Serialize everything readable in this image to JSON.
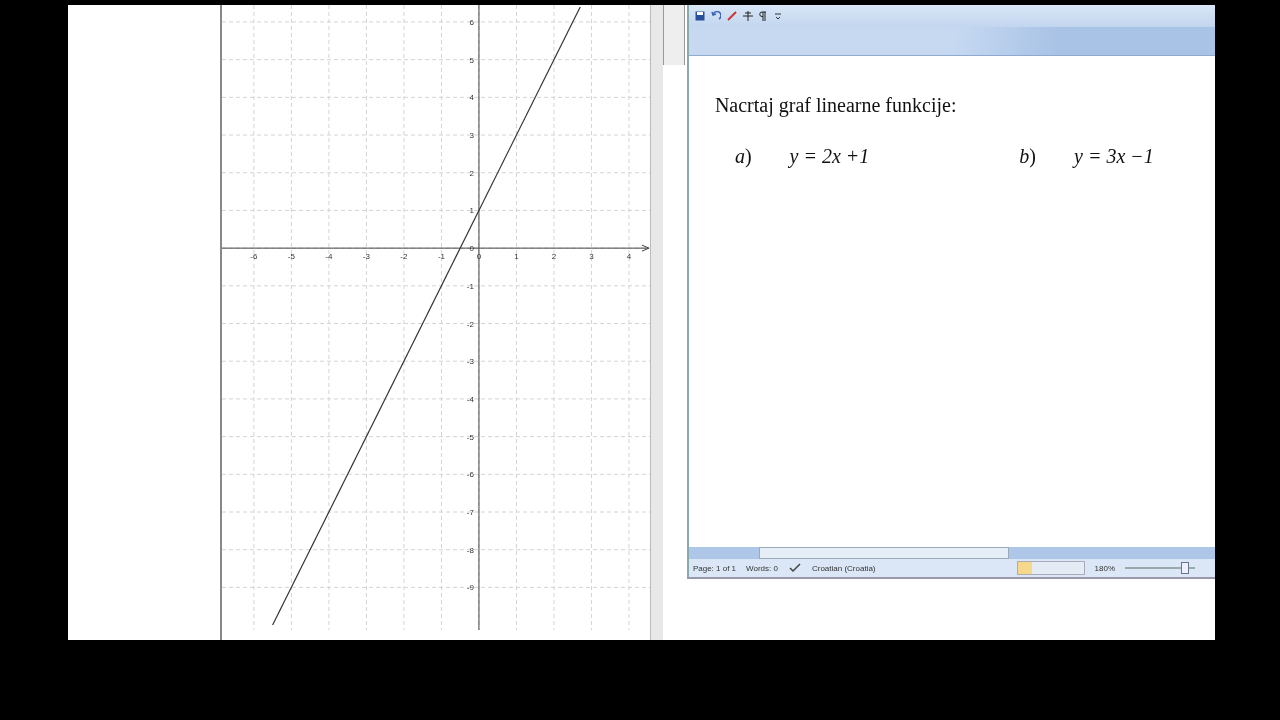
{
  "graphics": {
    "chart_data": {
      "type": "line",
      "grid": true,
      "xlim": [
        -6.85,
        4.56
      ],
      "ylim": [
        -10.13,
        6.45
      ],
      "xticks": [
        -6,
        -5,
        -4,
        -3,
        -2,
        -1,
        0,
        1,
        2,
        3,
        4
      ],
      "yticks": [
        -9,
        -8,
        -7,
        -6,
        -5,
        -4,
        -3,
        -2,
        -1,
        0,
        1,
        2,
        3,
        4,
        5,
        6
      ],
      "series": [
        {
          "color": "#333333",
          "x": [
            -5.5,
            2.7
          ],
          "values": [
            -10,
            6.4
          ]
        }
      ]
    }
  },
  "document": {
    "heading": "Nacrtaj graf linearne funkcije:",
    "tasks": [
      {
        "label": "*a*)",
        "equation": "y = 2x +1"
      },
      {
        "label": "*b*)",
        "equation": "y = 3x −1"
      }
    ]
  },
  "status_bar": {
    "page": "Page: 1 of 1",
    "words": "Words: 0",
    "language": "Croatian (Croatia)",
    "zoom": "180%",
    "zoom_slider": {
      "level": 0.9
    }
  }
}
